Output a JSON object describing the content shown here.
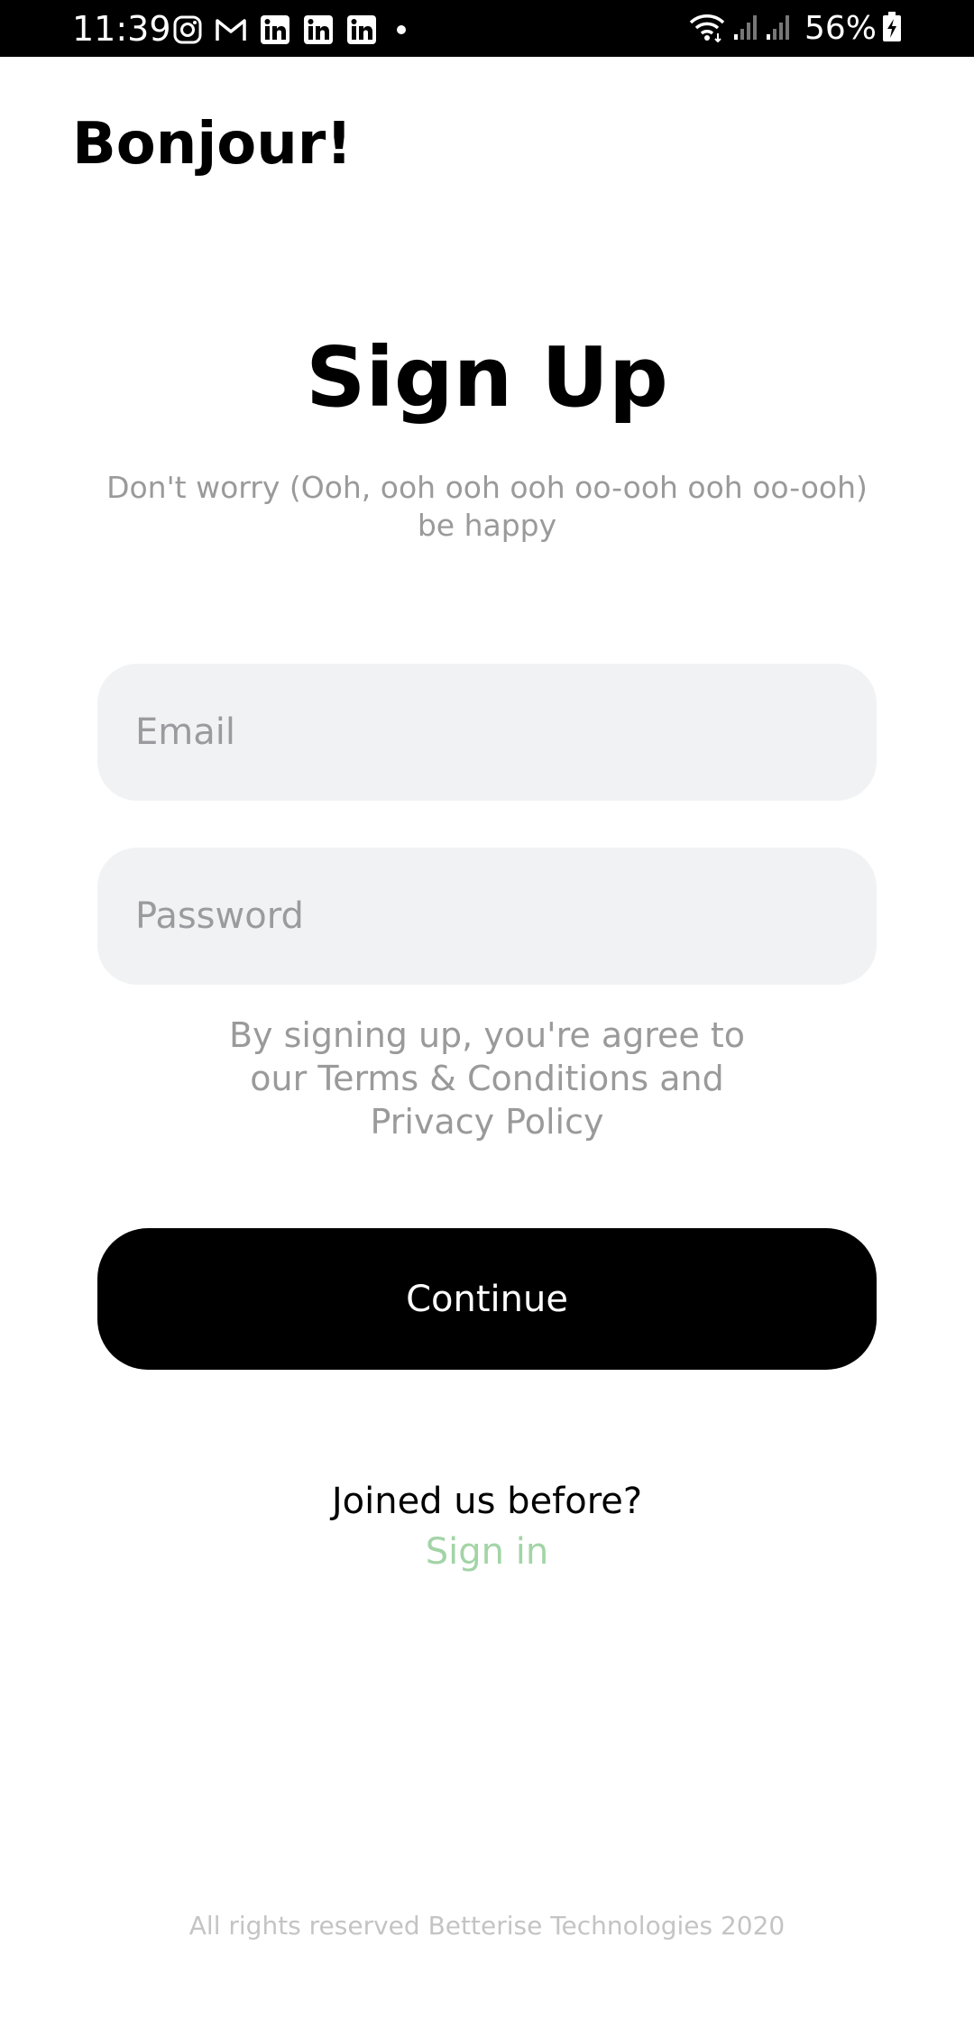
{
  "status_bar": {
    "time": "11:39",
    "battery": "56%",
    "left_icons": [
      "instagram-icon",
      "gmail-icon",
      "linkedin-icon",
      "linkedin-icon",
      "linkedin-icon",
      "dot-icon"
    ],
    "right_icons": [
      "wifi-icon",
      "signal-icon",
      "signal-icon",
      "battery-charging-icon"
    ]
  },
  "header": {
    "greeting": "Bonjour!"
  },
  "signup": {
    "title": "Sign Up",
    "subtitle": "Don't worry (Ooh, ooh ooh ooh oo-ooh ooh oo-ooh) be happy",
    "email": {
      "placeholder": "Email",
      "value": ""
    },
    "password": {
      "placeholder": "Password",
      "value": ""
    },
    "terms": "By signing up, you're agree to our Terms & Conditions and Privacy Policy",
    "continue_label": "Continue",
    "joined_text": "Joined us before?",
    "signin_label": "Sign in"
  },
  "footer": {
    "text": "All rights reserved Betterise Technologies 2020"
  },
  "colors": {
    "status_bar_bg": "#000000",
    "field_bg": "#f1f2f4",
    "button_bg": "#000000",
    "link": "#a3d4a6",
    "muted_text": "#9a9a9a"
  }
}
